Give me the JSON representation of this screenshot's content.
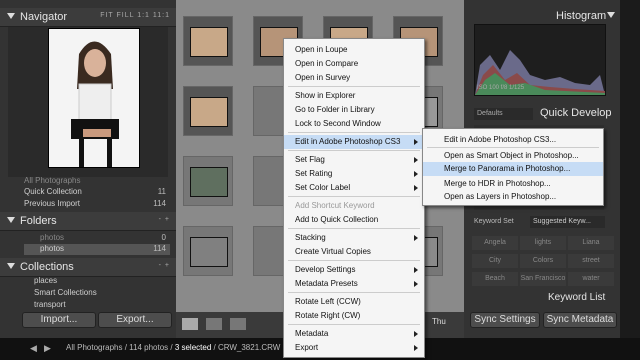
{
  "navigator": {
    "title": "Navigator",
    "modes": "FIT  FILL  1:1  11:1"
  },
  "catalog": {
    "rows": [
      {
        "label": "All Photographs",
        "count": ""
      },
      {
        "label": "Quick Collection",
        "count": "11"
      },
      {
        "label": "Previous Import",
        "count": "114"
      }
    ]
  },
  "folders": {
    "title": "Folders",
    "controls": "- +",
    "items": [
      {
        "label": "photos",
        "count": "0"
      },
      {
        "label": "photos",
        "count": "114"
      }
    ]
  },
  "collections": {
    "title": "Collections",
    "controls": "- +",
    "items": [
      "places",
      "Smart Collections",
      "transport"
    ]
  },
  "left_buttons": {
    "import": "Import...",
    "export": "Export..."
  },
  "right": {
    "histogram_title": "Histogram",
    "histo_info": "ISO 100   f/8   1/125",
    "preset": "Defaults",
    "quick_develop": "Quick Develop",
    "keyword_set_label": "Keyword Set",
    "keyword_set_value": "Suggested Keyw...",
    "keywords": [
      "Angela",
      "lights",
      "Liana",
      "City",
      "Colors",
      "street",
      "Beach",
      "San Francisco",
      "water"
    ],
    "keyword_list": "Keyword List",
    "sync_settings": "Sync Settings",
    "sync_metadata": "Sync Metadata"
  },
  "toolbar": {
    "sort": "Thu"
  },
  "status": {
    "text": "All Photographs / 114 photos / ",
    "selected": "3 selected",
    "file": " / CRW_3821.CRW"
  },
  "context_menu": {
    "items": [
      {
        "label": "Open in Loupe",
        "sub": false,
        "disabled": false
      },
      {
        "label": "Open in Compare",
        "sub": false,
        "disabled": false
      },
      {
        "label": "Open in Survey",
        "sub": false,
        "disabled": false
      },
      {
        "label": "Show in Explorer",
        "sub": false,
        "disabled": false
      },
      {
        "label": "Go to Folder in Library",
        "sub": false,
        "disabled": false
      },
      {
        "label": "Lock to Second Window",
        "sub": false,
        "disabled": false
      },
      {
        "label": "Edit in Adobe Photoshop CS3",
        "sub": true,
        "disabled": false
      },
      {
        "label": "Set Flag",
        "sub": true,
        "disabled": false
      },
      {
        "label": "Set Rating",
        "sub": true,
        "disabled": false
      },
      {
        "label": "Set Color Label",
        "sub": true,
        "disabled": false
      },
      {
        "label": "Add Shortcut Keyword",
        "sub": false,
        "disabled": true
      },
      {
        "label": "Add to Quick Collection",
        "sub": false,
        "disabled": false
      },
      {
        "label": "Stacking",
        "sub": true,
        "disabled": false
      },
      {
        "label": "Create Virtual Copies",
        "sub": false,
        "disabled": false
      },
      {
        "label": "Develop Settings",
        "sub": true,
        "disabled": false
      },
      {
        "label": "Metadata Presets",
        "sub": true,
        "disabled": false
      },
      {
        "label": "Rotate Left (CCW)",
        "sub": false,
        "disabled": false
      },
      {
        "label": "Rotate Right (CW)",
        "sub": false,
        "disabled": false
      },
      {
        "label": "Metadata",
        "sub": true,
        "disabled": false
      },
      {
        "label": "Export",
        "sub": true,
        "disabled": false
      }
    ]
  },
  "submenu": {
    "items": [
      "Edit in Adobe Photoshop CS3...",
      "Open as Smart Object in Photoshop...",
      "Merge to Panorama in Photoshop...",
      "Merge to HDR in Photoshop...",
      "Open as Layers in Photoshop..."
    ]
  }
}
